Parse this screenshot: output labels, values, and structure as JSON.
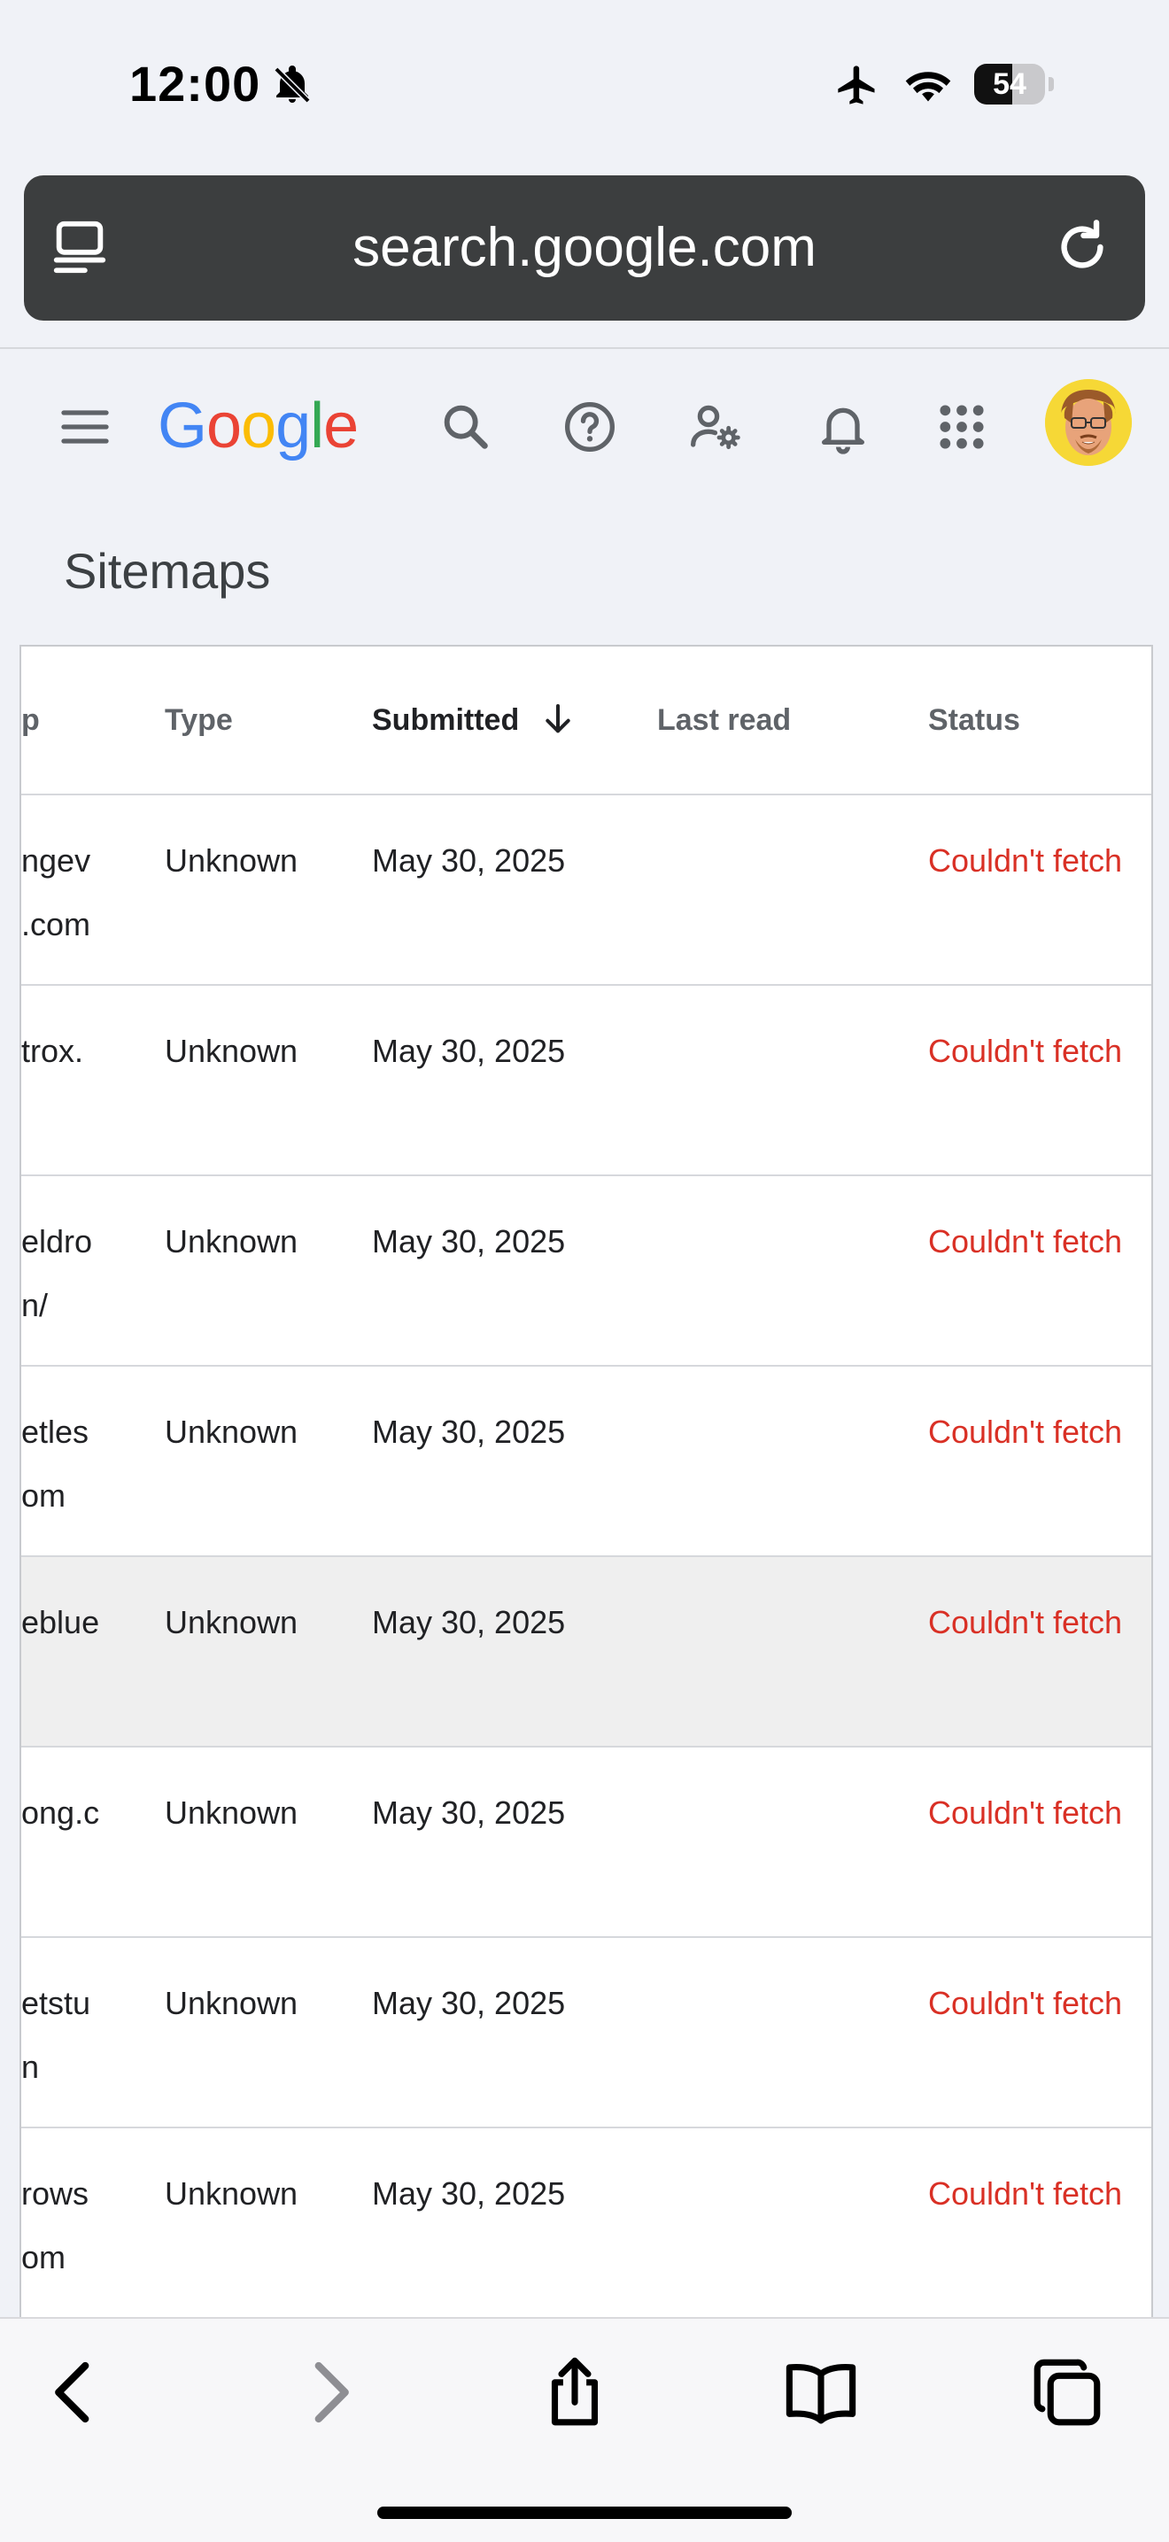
{
  "status_bar": {
    "time": "12:00",
    "battery_percent": "54",
    "icons": [
      "bell-off-icon",
      "airplane-icon",
      "wifi-icon",
      "battery-icon"
    ]
  },
  "browser": {
    "url": "search.google.com",
    "left_icon": "tab-overview-icon",
    "right_icon": "reload-icon"
  },
  "header": {
    "logo_letters": [
      {
        "ch": "G",
        "color": "#4285F4"
      },
      {
        "ch": "o",
        "color": "#EA4335"
      },
      {
        "ch": "o",
        "color": "#FBBC05"
      },
      {
        "ch": "g",
        "color": "#4285F4"
      },
      {
        "ch": "l",
        "color": "#34A853"
      },
      {
        "ch": "e",
        "color": "#EA4335"
      }
    ],
    "icons": [
      "menu-icon",
      "search-icon",
      "help-icon",
      "admin-settings-icon",
      "notifications-icon",
      "apps-icon",
      "avatar"
    ],
    "page_title": "Sitemaps"
  },
  "table": {
    "columns": {
      "sitemap": "p",
      "type": "Type",
      "submitted": "Submitted",
      "last_read": "Last read",
      "status": "Status"
    },
    "sort_column": "submitted",
    "rows": [
      {
        "url": "ngev\n.com",
        "type": "Unknown",
        "submitted": "May 30, 2025",
        "last_read": "",
        "status": "Couldn't fetch"
      },
      {
        "url": "trox.",
        "type": "Unknown",
        "submitted": "May 30, 2025",
        "last_read": "",
        "status": "Couldn't fetch"
      },
      {
        "url": "eldro\nn/",
        "type": "Unknown",
        "submitted": "May 30, 2025",
        "last_read": "",
        "status": "Couldn't fetch"
      },
      {
        "url": "etles\nom",
        "type": "Unknown",
        "submitted": "May 30, 2025",
        "last_read": "",
        "status": "Couldn't fetch"
      },
      {
        "url": "eblue",
        "type": "Unknown",
        "submitted": "May 30, 2025",
        "last_read": "",
        "status": "Couldn't fetch"
      },
      {
        "url": "ong.c",
        "type": "Unknown",
        "submitted": "May 30, 2025",
        "last_read": "",
        "status": "Couldn't fetch"
      },
      {
        "url": "etstu\nn",
        "type": "Unknown",
        "submitted": "May 30, 2025",
        "last_read": "",
        "status": "Couldn't fetch"
      },
      {
        "url": "rows\nom",
        "type": "Unknown",
        "submitted": "May 30, 2025",
        "last_read": "",
        "status": "Couldn't fetch"
      }
    ]
  },
  "toolbar": {
    "icons": [
      "back-icon",
      "forward-icon",
      "share-icon",
      "bookmarks-icon",
      "tabs-icon"
    ]
  },
  "colors": {
    "status_error": "#d93025",
    "highlight_row": "#efefef"
  }
}
